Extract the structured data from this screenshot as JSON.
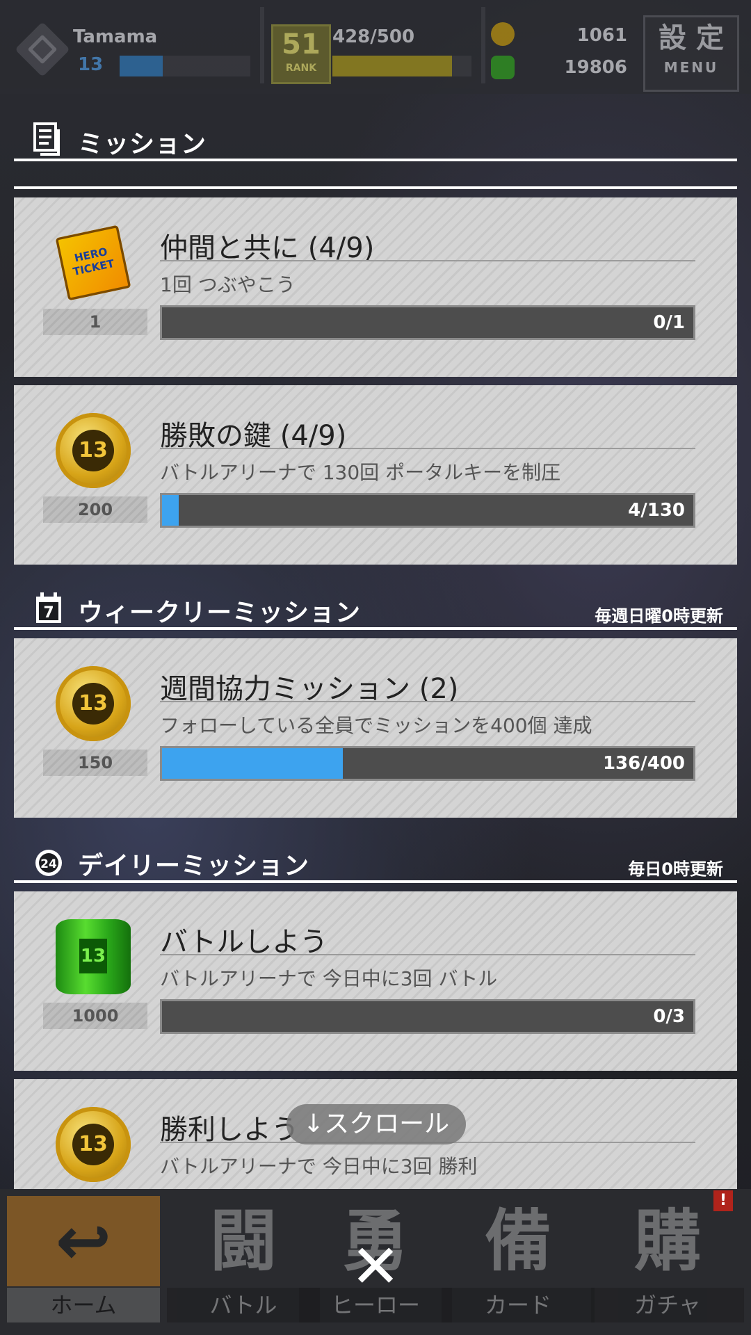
{
  "topbar": {
    "player_name": "Tamama",
    "player_level": "13",
    "level_progress": 0.33,
    "rank": "51",
    "rank_label": "RANK",
    "stamina": "428/500",
    "stamina_progress": 0.86,
    "currency_gold": "1061",
    "currency_green": "19806",
    "menu_main": "設 定",
    "menu_sub": "MENU"
  },
  "header": {
    "title": "ミッション",
    "icon": "document-list-icon"
  },
  "missions_top": [
    {
      "title": "仲間と共に (4/9)",
      "desc": "1回 つぶやこう",
      "reward_icon": "hero-ticket-icon",
      "reward_count": "1",
      "progress_text": "0/1",
      "progress": 0
    },
    {
      "title": "勝敗の鍵 (4/9)",
      "desc": "バトルアリーナで 130回 ポータルキーを制圧",
      "reward_icon": "gold-coin-icon",
      "reward_count": "200",
      "progress_text": "4/130",
      "progress": 0.031
    }
  ],
  "weekly": {
    "title": "ウィークリーミッション",
    "icon": "calendar-7-icon",
    "note": "毎週日曜0時更新",
    "missions": [
      {
        "title": "週間協力ミッション (2)",
        "desc": "フォローしている全員でミッションを400個 達成",
        "reward_icon": "gold-coin-icon",
        "reward_count": "150",
        "progress_text": "136/400",
        "progress": 0.34
      }
    ]
  },
  "daily": {
    "title": "デイリーミッション",
    "icon": "clock-24-icon",
    "note": "毎日0時更新",
    "missions": [
      {
        "title": "バトルしよう",
        "desc": "バトルアリーナで 今日中に3回 バトル",
        "reward_icon": "green-barrel-icon",
        "reward_count": "1000",
        "progress_text": "0/3",
        "progress": 0
      },
      {
        "title": "勝利しよう",
        "desc": "バトルアリーナで 今日中に3回 勝利",
        "reward_icon": "gold-coin-icon"
      }
    ]
  },
  "scroll_hint": "↓スクロール",
  "bottom_nav": [
    {
      "label": "ホーム",
      "glyph": "↩",
      "icon": "home-icon"
    },
    {
      "label": "バトル",
      "glyph": "闘",
      "icon": "battle-icon"
    },
    {
      "label": "ヒーロー",
      "glyph": "勇",
      "icon": "hero-icon"
    },
    {
      "label": "カード",
      "glyph": "備",
      "icon": "card-icon"
    },
    {
      "label": "ガチャ",
      "glyph": "購",
      "icon": "gacha-icon"
    }
  ],
  "close_glyph": "✕",
  "notify_badge": "!",
  "colors": {
    "progress_fill": "#3da3ef",
    "card_bg": "#d4d4d4",
    "header_text": "#ffffff"
  }
}
